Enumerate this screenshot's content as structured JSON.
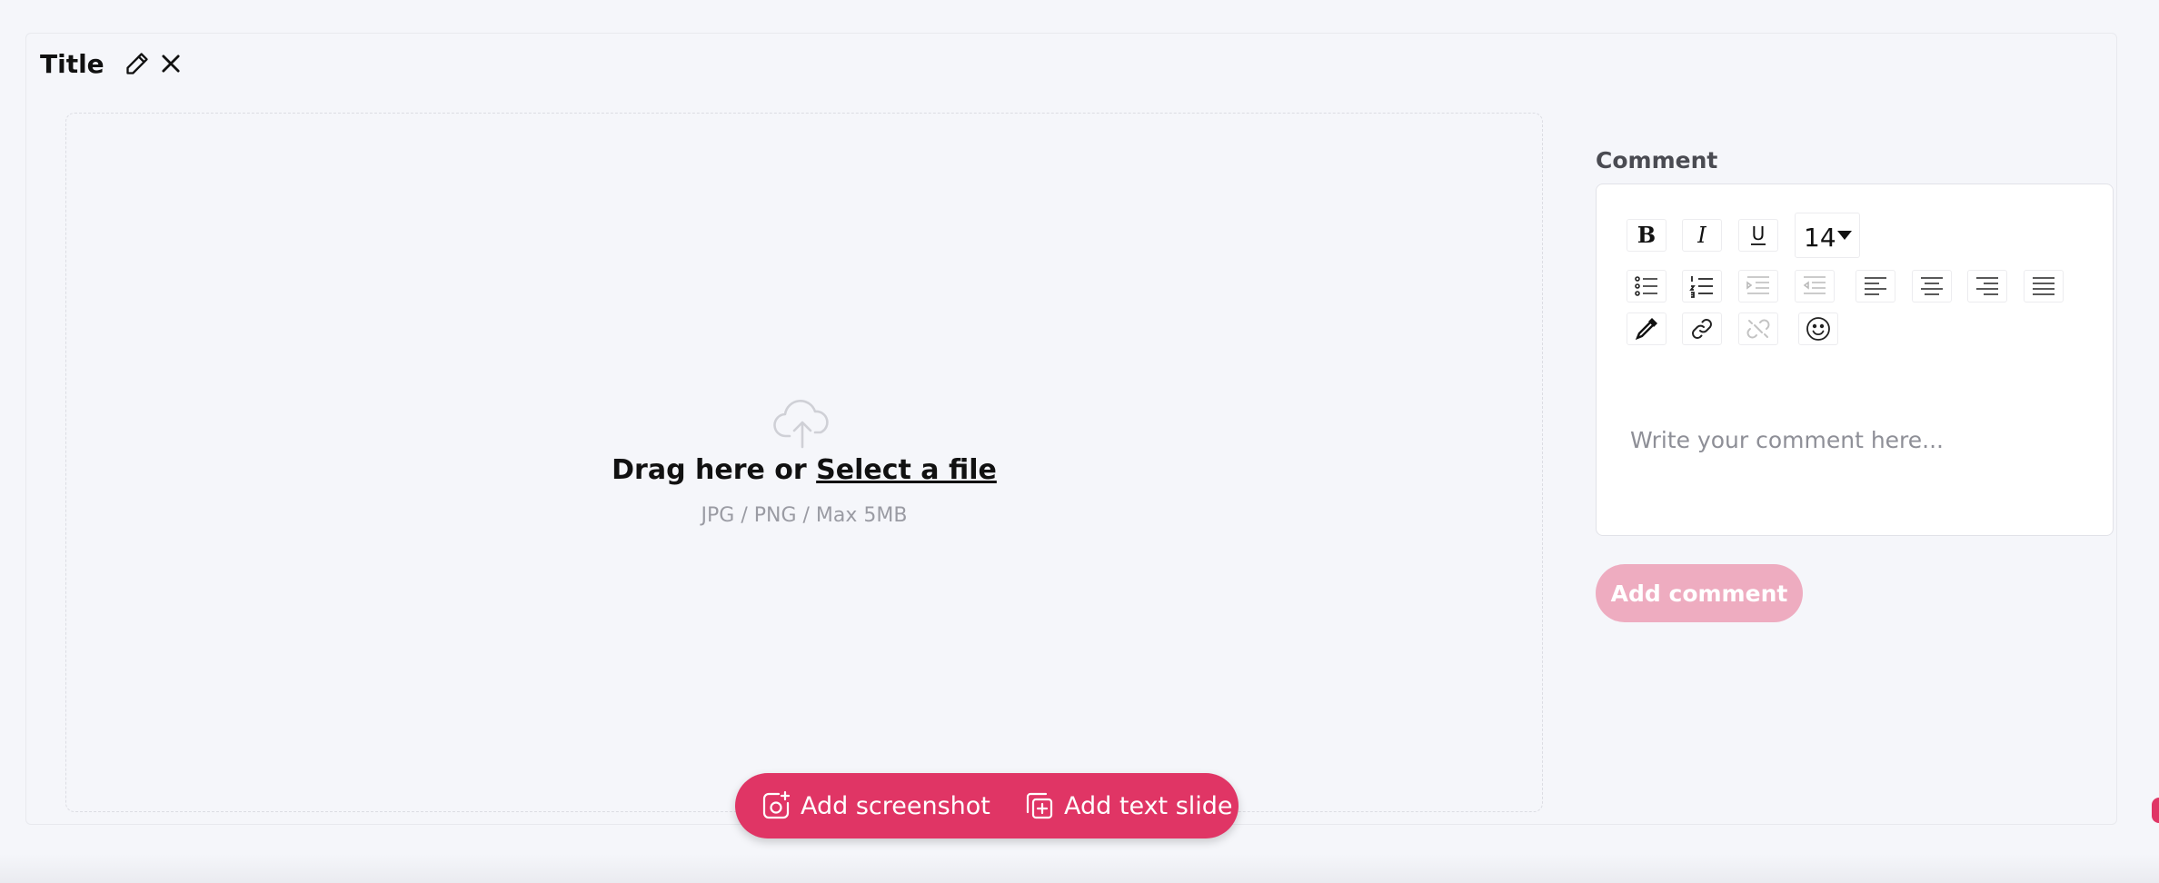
{
  "slide": {
    "title": "Title",
    "edit_icon": "pencil-icon",
    "close_icon": "close-icon"
  },
  "upload": {
    "icon": "cloud-upload-icon",
    "drag_text": "Drag here or ",
    "select_link": "Select a file",
    "hint": "JPG / PNG / Max 5MB"
  },
  "comment": {
    "label": "Comment",
    "font_size": "14",
    "placeholder": "Write your comment here...",
    "submit_label": "Add comment",
    "submit_color": "#eeacc0",
    "toolbar_icons": [
      "bold-icon",
      "italic-icon",
      "underline-icon",
      "bullet-list-icon",
      "numbered-list-icon",
      "indent-icon",
      "outdent-icon",
      "align-left-icon",
      "align-center-icon",
      "align-right-icon",
      "justify-icon",
      "eyedropper-icon",
      "link-icon",
      "unlink-icon",
      "emoji-icon"
    ]
  },
  "actions": {
    "add_screenshot": "Add screenshot",
    "add_text_slide": "Add text slide",
    "accent_color": "#e03565"
  }
}
